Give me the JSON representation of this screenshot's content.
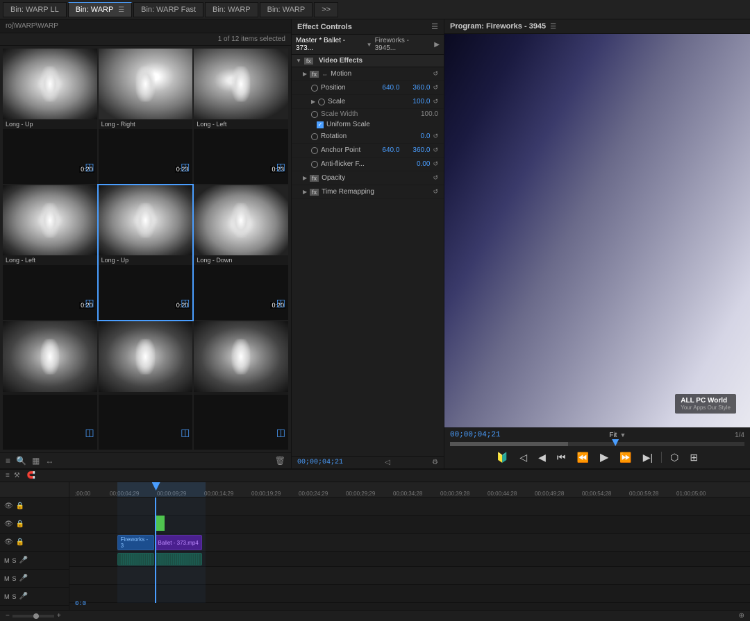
{
  "tabs": [
    {
      "id": "bin-warp-ll",
      "label": "Bin: WARP LL",
      "active": false
    },
    {
      "id": "bin-warp",
      "label": "Bin: WARP",
      "active": true,
      "hasMenu": true
    },
    {
      "id": "bin-warp-fast",
      "label": "Bin: WARP Fast",
      "active": false
    },
    {
      "id": "bin-warp2",
      "label": "Bin: WARP",
      "active": false
    },
    {
      "id": "bin-warp3",
      "label": "Bin: WARP",
      "active": false
    },
    {
      "id": "more",
      "label": ">>",
      "active": false
    }
  ],
  "bin": {
    "path": "roj\\WARP\\WARP",
    "selection_info": "1 of 12 items selected",
    "media_items": [
      {
        "id": 1,
        "label": "Long - Up",
        "duration": "0:20",
        "selected": false
      },
      {
        "id": 2,
        "label": "Long - Right",
        "duration": "0:23",
        "selected": false
      },
      {
        "id": 3,
        "label": "Long - Left",
        "duration": "0:23",
        "selected": false
      },
      {
        "id": 4,
        "label": "Long - Left",
        "duration": "0:20",
        "selected": false
      },
      {
        "id": 5,
        "label": "Long - Up",
        "duration": "0:20",
        "selected": true
      },
      {
        "id": 6,
        "label": "Long - Down",
        "duration": "0:20",
        "selected": false
      },
      {
        "id": 7,
        "label": "",
        "duration": "",
        "selected": false
      },
      {
        "id": 8,
        "label": "",
        "duration": "",
        "selected": false
      },
      {
        "id": 9,
        "label": "",
        "duration": "",
        "selected": false
      }
    ]
  },
  "effect_controls": {
    "panel_title": "Effect Controls",
    "master_label": "Master * Ballet - 373...",
    "source_label": "Fireworks - 3945...",
    "sections": {
      "video_effects_label": "Video Effects",
      "motion_label": "Motion",
      "position_label": "Position",
      "position_x": "640.0",
      "position_y": "360.0",
      "scale_label": "Scale",
      "scale_value": "100.0",
      "scale_width_label": "Scale Width",
      "scale_width_value": "100.0",
      "uniform_scale_label": "Uniform Scale",
      "rotation_label": "Rotation",
      "rotation_value": "0.0",
      "anchor_point_label": "Anchor Point",
      "anchor_x": "640.0",
      "anchor_y": "360.0",
      "anti_flicker_label": "Anti-flicker F...",
      "anti_flicker_value": "0.00",
      "opacity_label": "Opacity",
      "time_remapping_label": "Time Remapping"
    },
    "timecode": "00;00;04;21"
  },
  "program_monitor": {
    "title": "Program: Fireworks - 3945",
    "timecode": "00;00;04;21",
    "fit_label": "Fit",
    "page_indicator": "1/4",
    "watermark_title": "ALL PC World",
    "watermark_sub": "Your Apps Our Style"
  },
  "timeline": {
    "header_icon": "≡",
    "timecode_display": "0:0",
    "ruler_marks": [
      ";00;00",
      "00;00;04;29",
      "00;00;09;29",
      "00;00;14;29",
      "00;00;19;29",
      "00;00;24;29",
      "00;00;29;29",
      "00;00;34;28",
      "00;00;39;28",
      "00;00;44;28",
      "00;00;49;28",
      "00;00;54;28",
      "00;00;59;28",
      "01;00;05;00"
    ],
    "tracks": [
      {
        "id": "v3",
        "type": "video",
        "label": ""
      },
      {
        "id": "v2",
        "type": "video",
        "label": ""
      },
      {
        "id": "v1",
        "type": "video",
        "label": ""
      },
      {
        "id": "a1",
        "type": "audio",
        "label": "M S"
      },
      {
        "id": "a2",
        "type": "audio",
        "label": "M S"
      },
      {
        "id": "a3",
        "type": "audio",
        "label": "M S"
      }
    ],
    "clips": [
      {
        "id": "c1",
        "track": "v1",
        "label": "Fireworks - 3",
        "start_pct": 10,
        "width_pct": 5,
        "type": "video"
      },
      {
        "id": "c2",
        "track": "v1",
        "label": "Ballet - 373.mp4",
        "start_pct": 15,
        "width_pct": 7,
        "type": "video2"
      },
      {
        "id": "c3",
        "track": "a1",
        "label": "",
        "start_pct": 10,
        "width_pct": 5,
        "type": "audio"
      },
      {
        "id": "c4",
        "track": "a1",
        "label": "",
        "start_pct": 15,
        "width_pct": 7,
        "type": "audio"
      }
    ],
    "playhead_pct": 15,
    "in_out_start": 10,
    "in_out_end": 22
  },
  "toolbar": {
    "list_icon": "≡",
    "search_icon": "🔍",
    "grid_icon": "▦",
    "auto_icon": "↔",
    "delete_icon": "🗑"
  }
}
